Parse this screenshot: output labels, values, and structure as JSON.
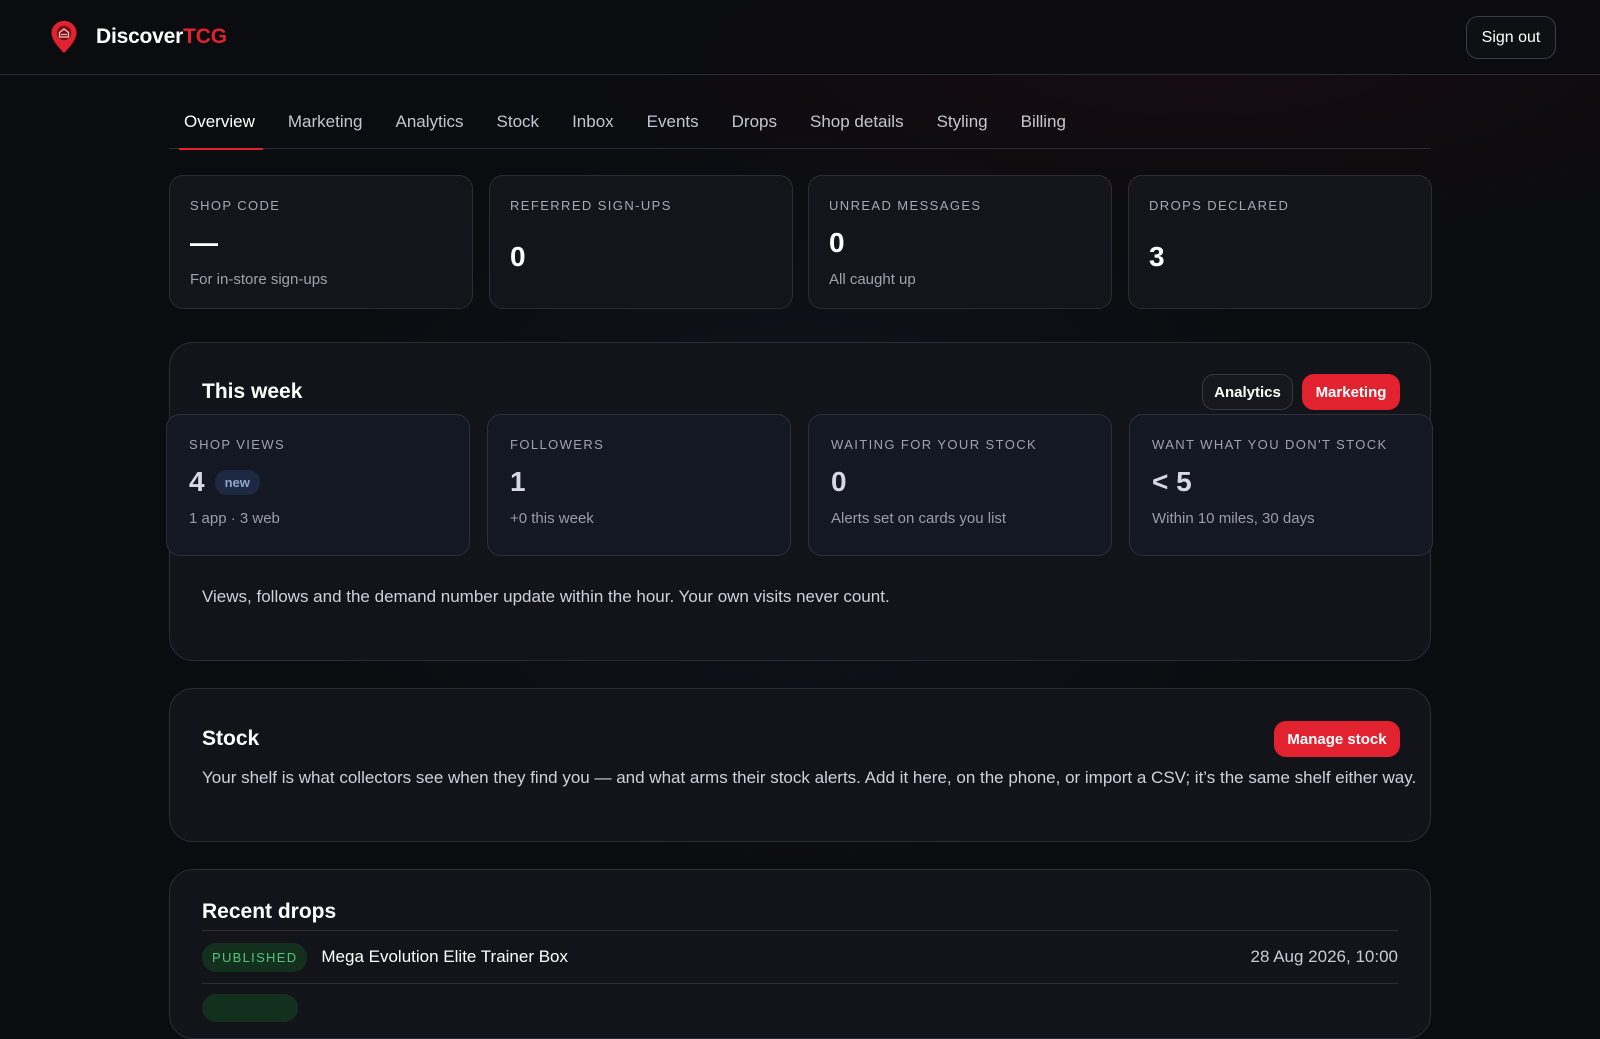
{
  "header": {
    "brand_part1": "Discover",
    "brand_part2": "TCG",
    "logo_icon": "map-pin-icon",
    "sign_out_label": "Sign out"
  },
  "tabs": [
    {
      "label": "Overview",
      "active": true
    },
    {
      "label": "Marketing"
    },
    {
      "label": "Analytics"
    },
    {
      "label": "Stock"
    },
    {
      "label": "Inbox"
    },
    {
      "label": "Events"
    },
    {
      "label": "Drops"
    },
    {
      "label": "Shop details"
    },
    {
      "label": "Styling"
    },
    {
      "label": "Billing"
    }
  ],
  "stats": [
    {
      "label": "SHOP CODE",
      "value": "—",
      "sub": "For in-store sign-ups"
    },
    {
      "label": "REFERRED SIGN-UPS",
      "value": "0",
      "sub": ""
    },
    {
      "label": "UNREAD MESSAGES",
      "value": "0",
      "sub": "All caught up"
    },
    {
      "label": "DROPS DECLARED",
      "value": "3",
      "sub": ""
    }
  ],
  "this_week": {
    "title": "This week",
    "analytics_button": "Analytics",
    "marketing_button": "Marketing",
    "metrics": [
      {
        "label": "SHOP VIEWS",
        "value": "4",
        "badge": "new",
        "sub": "1 app · 3 web"
      },
      {
        "label": "FOLLOWERS",
        "value": "1",
        "sub": "+0 this week"
      },
      {
        "label": "WAITING FOR YOUR STOCK",
        "value": "0",
        "sub": "Alerts set on cards you list"
      },
      {
        "label": "WANT WHAT YOU DON'T STOCK",
        "value": "< 5",
        "sub": "Within 10 miles, 30 days"
      }
    ],
    "note": "Views, follows and the demand number update within the hour. Your own visits never count."
  },
  "stock": {
    "title": "Stock",
    "manage_button": "Manage stock",
    "description": "Your shelf is what collectors see when they find you — and what arms their stock alerts. Add it here, on the phone, or import a CSV; it’s the same shelf either way."
  },
  "recent_drops": {
    "title": "Recent drops",
    "items": [
      {
        "status": "PUBLISHED",
        "name": "Mega Evolution Elite Trainer Box",
        "date": "28 Aug 2026, 10:00"
      }
    ]
  },
  "colors": {
    "accent": "#e3222f",
    "background": "#0b0c10",
    "published_green": "#57c27c"
  }
}
